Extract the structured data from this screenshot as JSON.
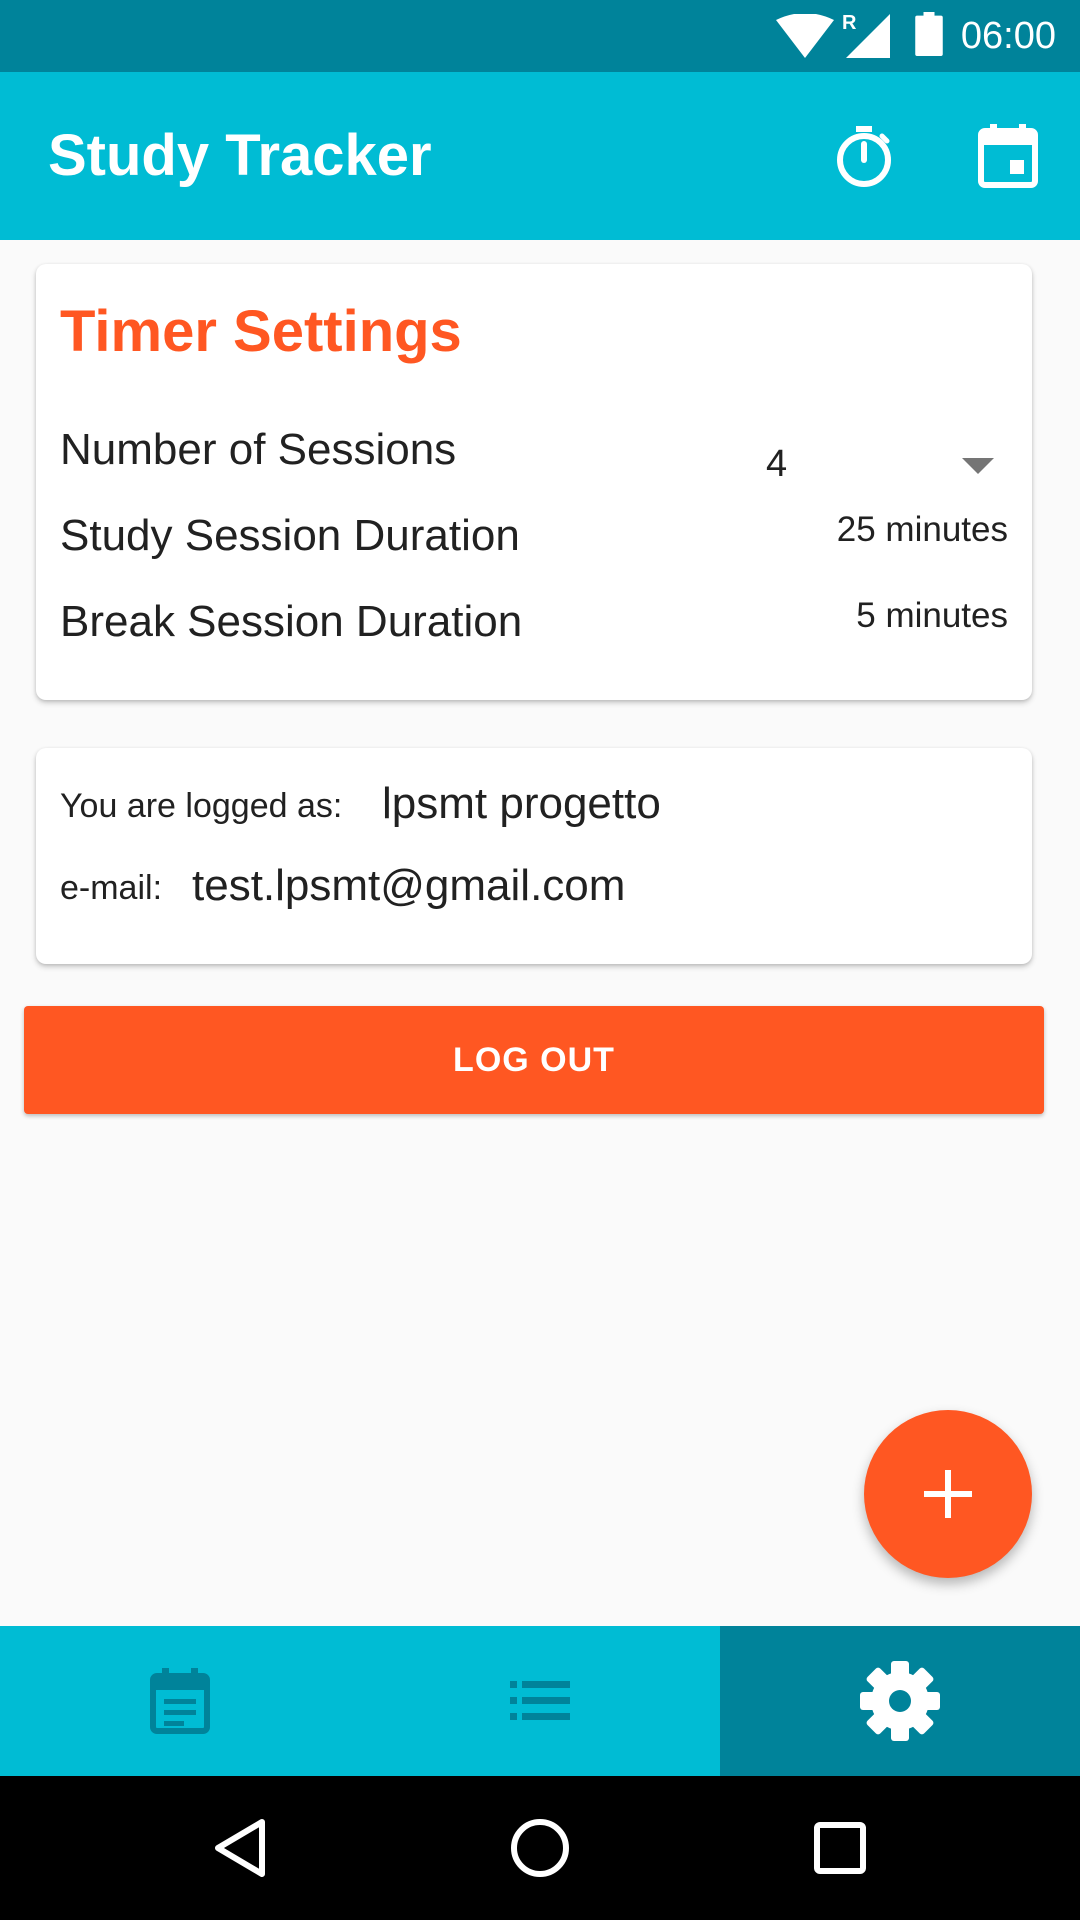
{
  "status_bar": {
    "time": "06:00",
    "roaming_indicator": "R",
    "icons": [
      "wifi-icon",
      "signal-icon",
      "battery-icon"
    ]
  },
  "app_bar": {
    "title": "Study Tracker",
    "actions": [
      "timer-icon",
      "calendar-icon"
    ]
  },
  "timer_settings": {
    "title": "Timer Settings",
    "sessions_label": "Number of Sessions",
    "sessions_value": "4",
    "study_label": "Study Session Duration",
    "study_value": "25 minutes",
    "break_label": "Break Session Duration",
    "break_value": "5 minutes"
  },
  "account": {
    "logged_label": "You are logged as:",
    "username": "lpsmt progetto",
    "email_label": "e-mail:",
    "email": "test.lpsmt@gmail.com"
  },
  "logout_label": "LOG OUT",
  "fab_icon": "plus-icon",
  "bottom_nav": {
    "items": [
      "event-note-icon",
      "list-icon",
      "settings-gear-icon"
    ],
    "active_index": 2
  },
  "system_nav": [
    "back-icon",
    "home-icon",
    "recents-icon"
  ],
  "colors": {
    "primary": "#00bcd4",
    "primary_dark": "#00839a",
    "accent": "#ff5722"
  }
}
